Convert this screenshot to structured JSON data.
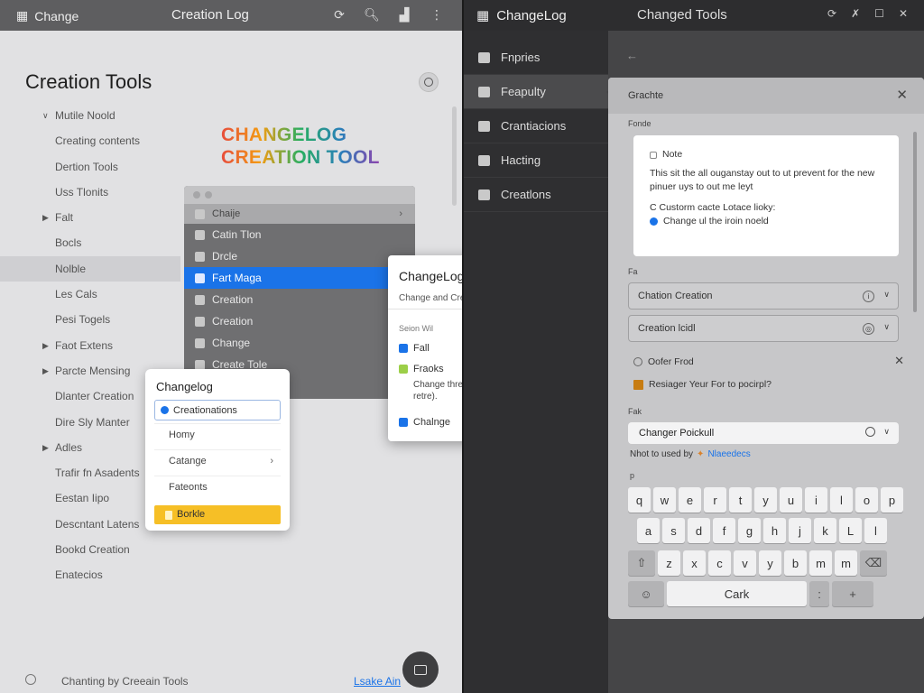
{
  "left": {
    "titlebar": {
      "app": "Change",
      "center": "Creation Log"
    },
    "heading": "Creation Tools",
    "nav": [
      {
        "label": "Mutile Noold",
        "caret": "v"
      },
      {
        "label": "Creating contents",
        "caret": ""
      },
      {
        "label": "Dertion Tools",
        "caret": ""
      },
      {
        "label": "Uss Tlonits",
        "caret": ""
      },
      {
        "label": "Falt",
        "caret": ">"
      },
      {
        "label": "Bocls",
        "caret": ""
      },
      {
        "label": "Nolble",
        "caret": "",
        "active": true
      },
      {
        "label": "Les Cals",
        "caret": ""
      },
      {
        "label": "Pesi Togels",
        "caret": ""
      },
      {
        "label": "Faot Extens",
        "caret": ">"
      },
      {
        "label": "Parcte Mensing",
        "caret": ">"
      },
      {
        "label": "Dlanter Creation",
        "caret": ""
      },
      {
        "label": "Dire Sly Manter",
        "caret": ""
      },
      {
        "label": "Adles",
        "caret": ">"
      },
      {
        "label": "Trafir fn Asadents",
        "caret": ""
      },
      {
        "label": "Eestan Iipo",
        "caret": ""
      },
      {
        "label": "Descntant Latens",
        "caret": ""
      },
      {
        "label": "Bookd Creation",
        "caret": ""
      },
      {
        "label": "Enatecios",
        "caret": ""
      }
    ],
    "logo": {
      "line1": "CHANGELOG",
      "line2": "CREATION TOOL"
    },
    "gray_menu": {
      "header": "Chaije",
      "items": [
        "Catin Tlon",
        "Drcle",
        "Fart Maga",
        "Creation",
        "Creation",
        "Change",
        "Create Tole"
      ],
      "selected_index": 2
    },
    "dropdown": {
      "title": "Changelog",
      "input": "Creationations",
      "items": [
        "Homy",
        "Catange",
        "Fateonts"
      ],
      "highlight": "Borkle"
    },
    "changelog_dialog": {
      "title": "ChangeLog",
      "subtitle": "Change and Creating Coneations felh Tools",
      "section": "Seion Wil",
      "option1": "Fall",
      "option2": "Fraoks",
      "option2_desc": "Change thre fele tor (fio pr and Wl is retre).",
      "option3": "Chalnge"
    },
    "footer": {
      "text": "Chanting by Creeain Tools",
      "link": "Lsake Ain"
    }
  },
  "right": {
    "titlebar": {
      "app": "ChangeLog",
      "center": "Changed Tools"
    },
    "sidebar": [
      {
        "label": "Fnpries"
      },
      {
        "label": "Feapulty",
        "active": true
      },
      {
        "label": "Crantiacions"
      },
      {
        "label": "Hacting"
      },
      {
        "label": "Creatlons"
      }
    ],
    "sheet": {
      "title": "Grachte",
      "label_top": "Fonde",
      "note": {
        "title": "Note",
        "body": "This sit the all ouganstay out to ut prevent for the new pinuer uys to out me leyt",
        "line1": "C Custorm cacte Lotace lioky:",
        "line2": "Change ul the iroin noeld"
      },
      "label_fields": "Fa",
      "field1": "Chation Creation",
      "field2": "Creation lcidl",
      "option_a": "Oofer Frod",
      "option_b": "Resiager Yeur For to pocirpl?",
      "label_search": "Fak",
      "search_value": "Changer Poickull",
      "hint": "Nhot to used by",
      "hint_link": "Nlaeedecs",
      "label_kb": "p"
    },
    "keyboard": {
      "row1": [
        "q",
        "w",
        "e",
        "r",
        "t",
        "y",
        "u",
        "i",
        "l",
        "o",
        "p"
      ],
      "row2": [
        "a",
        "s",
        "d",
        "f",
        "g",
        "h",
        "j",
        "k",
        "L",
        "l"
      ],
      "row3": [
        "⇧",
        "z",
        "x",
        "c",
        "v",
        "y",
        "b",
        "m",
        "m",
        "⌫"
      ],
      "row4": [
        "☺",
        "Cark",
        ":",
        "+"
      ]
    }
  }
}
